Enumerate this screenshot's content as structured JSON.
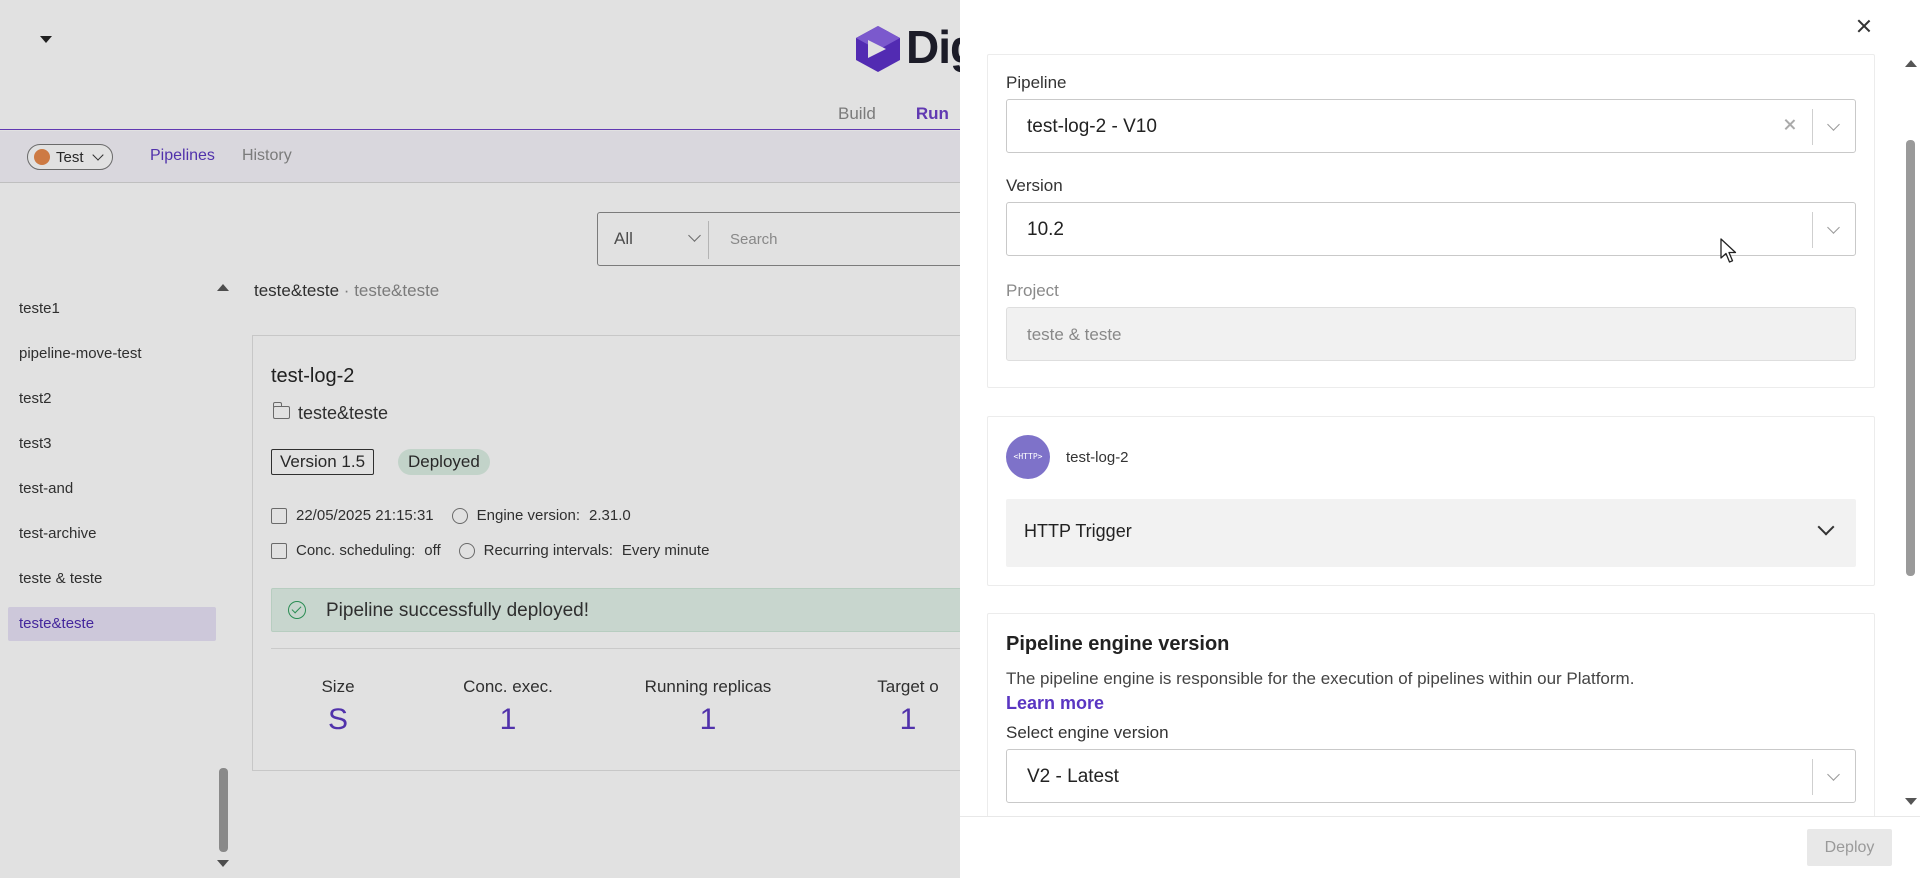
{
  "header": {
    "logo_text": "Dig",
    "tabs": [
      {
        "label": "Build"
      },
      {
        "label": "Run"
      }
    ]
  },
  "subbar": {
    "environment": "Test",
    "nav": [
      {
        "label": "Pipelines"
      },
      {
        "label": "History"
      }
    ]
  },
  "filter": {
    "type_value": "All",
    "search_placeholder": "Search"
  },
  "pipeline_list": [
    {
      "name": "teste1"
    },
    {
      "name": "pipeline-move-test"
    },
    {
      "name": "test2"
    },
    {
      "name": "test3"
    },
    {
      "name": "test-and"
    },
    {
      "name": "test-archive"
    },
    {
      "name": "teste & teste"
    },
    {
      "name": "teste&teste"
    }
  ],
  "breadcrumb": {
    "main": "teste&teste",
    "separator": "·",
    "sub": "teste&teste"
  },
  "card": {
    "title": "test-log-2",
    "project": "teste&teste",
    "version": "Version 1.5",
    "status": "Deployed",
    "date": "22/05/2025 21:15:31",
    "engine_label": "Engine version:",
    "engine_value": "2.31.0",
    "conc_label": "Conc. scheduling:",
    "conc_value": "off",
    "recurring_label": "Recurring intervals:",
    "recurring_value": "Every minute",
    "success_message": "Pipeline successfully deployed!",
    "stats": [
      {
        "label": "Size",
        "value": "S"
      },
      {
        "label": "Conc. exec.",
        "value": "1"
      },
      {
        "label": "Running replicas",
        "value": "1"
      },
      {
        "label": "Target o",
        "value": "1"
      }
    ]
  },
  "drawer": {
    "pipeline_label": "Pipeline",
    "pipeline_value": "test-log-2 - V10",
    "version_label": "Version",
    "version_value": "10.2",
    "project_label": "Project",
    "project_value": "teste & teste",
    "trigger_avatar_text": "<HTTP>",
    "trigger_name": "test-log-2",
    "trigger_type": "HTTP Trigger",
    "engine_title": "Pipeline engine version",
    "engine_desc": "The pipeline engine is responsible for the execution of pipelines within our Platform.",
    "engine_link": "Learn more",
    "engine_select_label": "Select engine version",
    "engine_select_value": "V2 - Latest",
    "deploy_label": "Deploy"
  },
  "colors": {
    "accent": "#5a36c2",
    "success_bg": "#e3f3ea",
    "env_dot": "#e8894a"
  }
}
